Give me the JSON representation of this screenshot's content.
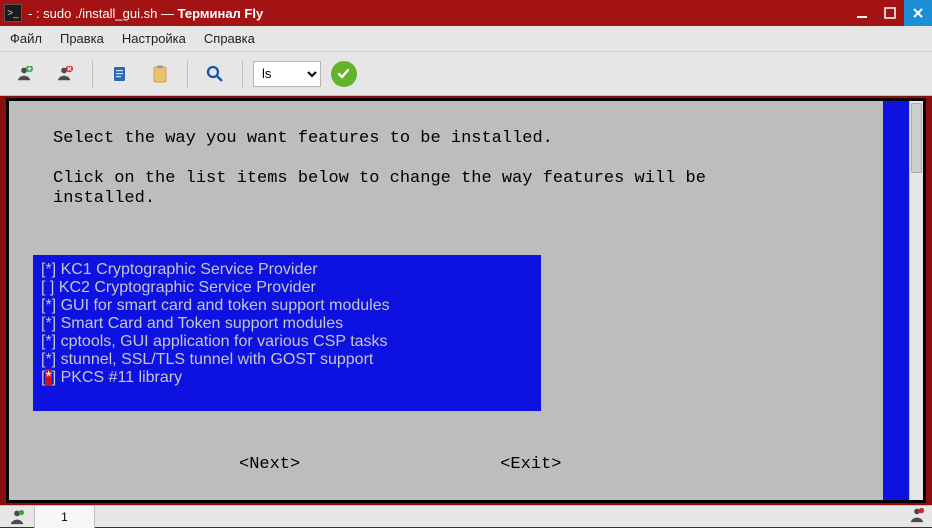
{
  "window": {
    "title_prefix": "- : sudo ./install_gui.sh — ",
    "title_app": "Терминал Fly"
  },
  "menu": {
    "file": "Файл",
    "edit": "Правка",
    "settings": "Настройка",
    "help": "Справка"
  },
  "toolbar": {
    "select_value": "ls"
  },
  "tui": {
    "line1": "Select the way you want features to be installed.",
    "line2": "Click on the list items below to change the way features will be",
    "line3": "installed.",
    "features": [
      {
        "mark": "[*]",
        "label": "KC1 Cryptographic Service Provider",
        "hot": false
      },
      {
        "mark": "[ ]",
        "label": "KC2 Cryptographic Service Provider",
        "hot": false
      },
      {
        "mark": "[*]",
        "label": "GUI for smart card and token support modules",
        "hot": false
      },
      {
        "mark": "[*]",
        "label": "Smart Card and Token support modules",
        "hot": false
      },
      {
        "mark": "[*]",
        "label": "cptools, GUI application for various CSP tasks",
        "hot": false
      },
      {
        "mark": "[*]",
        "label": "stunnel, SSL/TLS tunnel with GOST support",
        "hot": false
      },
      {
        "mark": "[*]",
        "label": "PKCS #11 library",
        "hot": true
      }
    ],
    "next": "<Next>",
    "exit": "<Exit>"
  },
  "status": {
    "tab_number": "1"
  }
}
